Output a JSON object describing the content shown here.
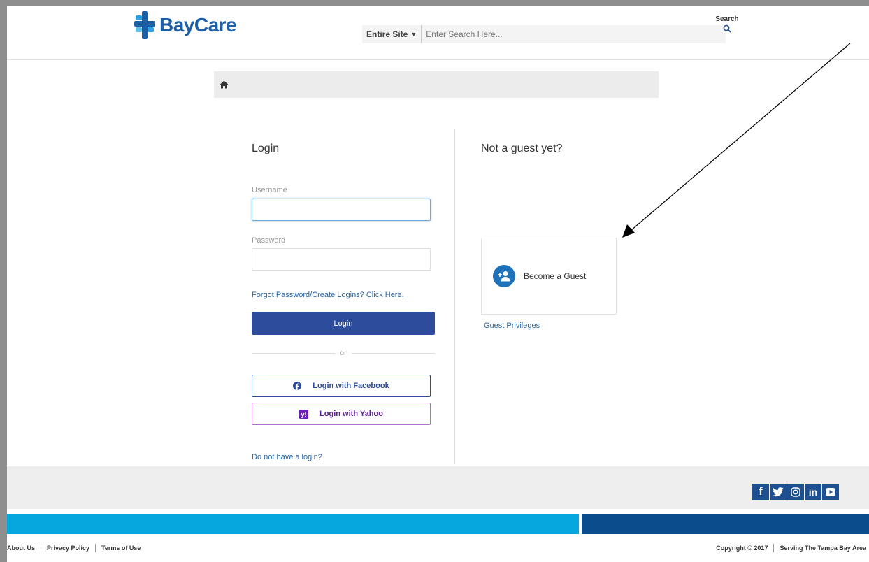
{
  "header": {
    "brand": "BayCare",
    "search_scope": "Entire Site",
    "search_placeholder": "Enter Search Here...",
    "search_label": "Search"
  },
  "login": {
    "title": "Login",
    "username_label": "Username",
    "username_value": "",
    "password_label": "Password",
    "password_value": "",
    "forgot_link": "Forgot Password/Create Logins? Click Here.",
    "login_button": "Login",
    "or_text": "or",
    "facebook_button": "Login with Facebook",
    "yahoo_button": "Login with Yahoo",
    "no_login_link": "Do not have a login?"
  },
  "guest": {
    "title": "Not a guest yet?",
    "become_guest": "Become a Guest",
    "privileges_link": "Guest Privileges"
  },
  "footer": {
    "links": [
      "About Us",
      "Privacy Policy",
      "Terms of Use"
    ],
    "copyright": "Copyright © 2017",
    "tagline": "Serving The Tampa Bay Area",
    "social": [
      "facebook-icon",
      "twitter-icon",
      "instagram-icon",
      "linkedin-icon",
      "youtube-icon"
    ]
  },
  "colors": {
    "brand_blue": "#1d5fa6",
    "login_button": "#2d4d9c",
    "footer_light": "#05a7de",
    "footer_dark": "#0b4c8c",
    "yahoo_purple": "#5a1e96"
  }
}
